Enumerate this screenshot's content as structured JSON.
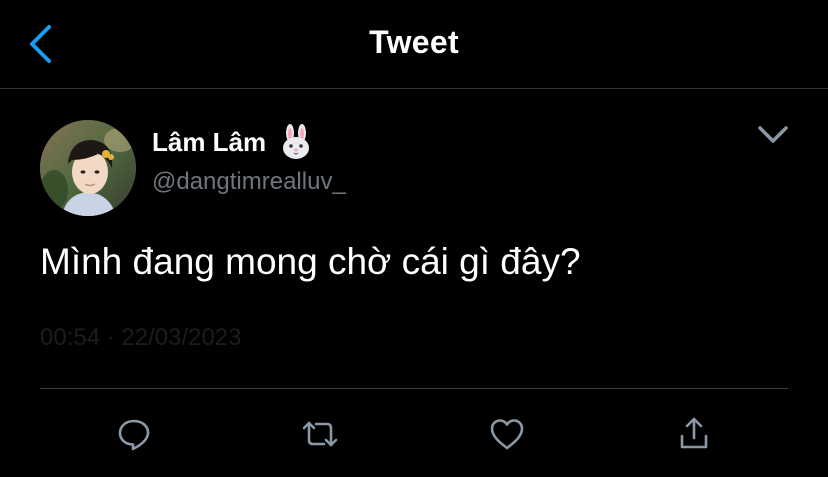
{
  "header": {
    "back_icon": "chevron-left-icon",
    "title": "Tweet"
  },
  "tweet": {
    "display_name": "Lâm Lâm",
    "name_emoji": "rabbit-face-emoji",
    "handle": "@dangtimrealluv_",
    "text": "Mình đang mong chờ cái gì đây?",
    "timestamp": "00:54 · 22/03/2023",
    "menu_icon": "chevron-down-icon"
  },
  "actions": [
    {
      "name": "reply",
      "icon": "reply-icon"
    },
    {
      "name": "retweet",
      "icon": "retweet-icon"
    },
    {
      "name": "like",
      "icon": "heart-icon"
    },
    {
      "name": "share",
      "icon": "share-icon"
    }
  ],
  "colors": {
    "background": "#000000",
    "accent": "#1d9bf0",
    "secondary_text": "#6e767d",
    "icon": "#8b98a5",
    "divider": "#2f3336"
  }
}
